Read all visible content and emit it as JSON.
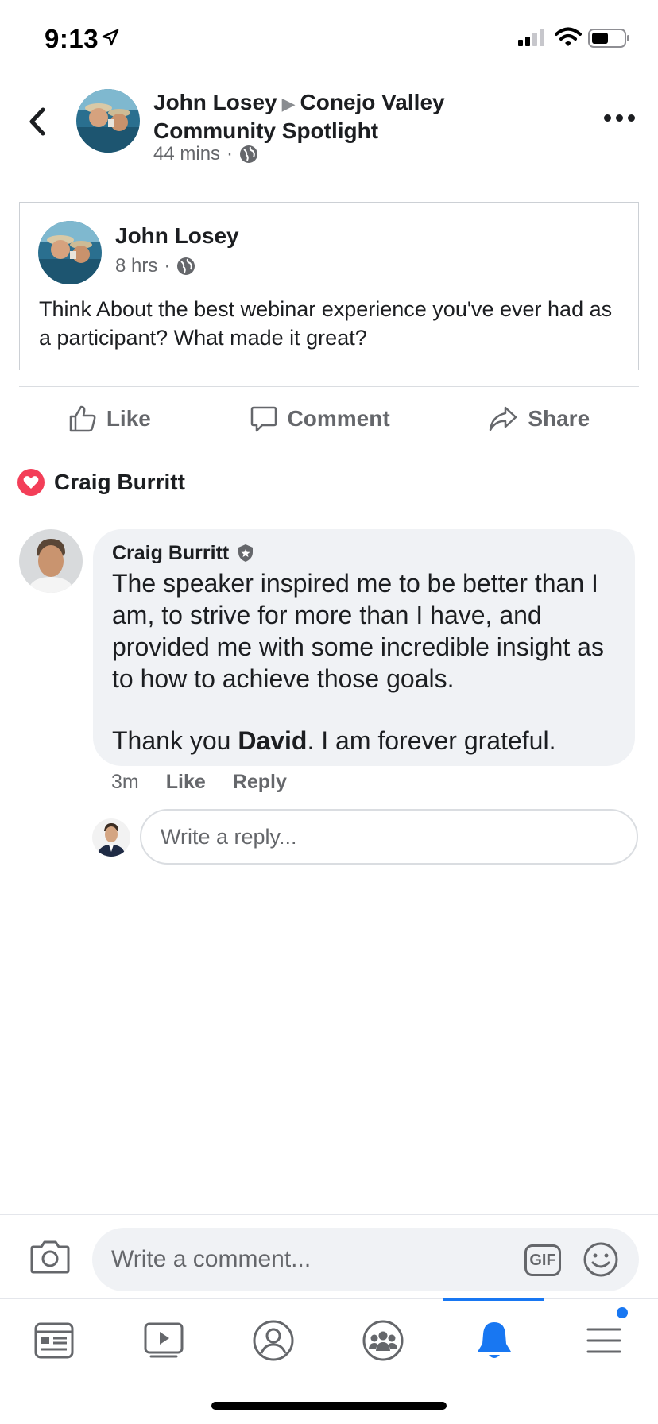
{
  "status_bar": {
    "time": "9:13"
  },
  "post": {
    "author": "John Losey",
    "group": "Conejo Valley Community Spotlight",
    "time": "44 mins",
    "icons": [
      "back-chevron-icon",
      "globe-icon",
      "more-dots-icon"
    ]
  },
  "shared_post": {
    "author": "John Losey",
    "time": "8 hrs",
    "text": "Think About the best webinar experience you've ever had as a participant? What made it great?"
  },
  "actions": {
    "like": "Like",
    "comment": "Comment",
    "share": "Share"
  },
  "reaction": {
    "name": "Craig Burritt",
    "type": "heart-icon"
  },
  "comment": {
    "author": "Craig Burritt",
    "text_line1": "The speaker inspired me to be better than I am, to strive for more than I have, and provided me with some incredible insight as to how to achieve those goals.",
    "text_pre": "Thank you ",
    "text_bold": "David",
    "text_post": ". I am forever grateful.",
    "time": "3m",
    "like": "Like",
    "reply": "Reply"
  },
  "reply_box": {
    "placeholder": "Write a reply..."
  },
  "composer": {
    "placeholder": "Write a comment...",
    "gif_label": "GIF"
  },
  "nav": {
    "items": [
      "news-feed-icon",
      "watch-icon",
      "profile-icon",
      "groups-icon",
      "notifications-icon",
      "menu-icon"
    ],
    "active": "notifications-icon"
  },
  "colors": {
    "accent": "#1877f2",
    "secondary_text": "#65676b",
    "bubble_bg": "#f0f2f5",
    "heart": "#f33e58"
  }
}
